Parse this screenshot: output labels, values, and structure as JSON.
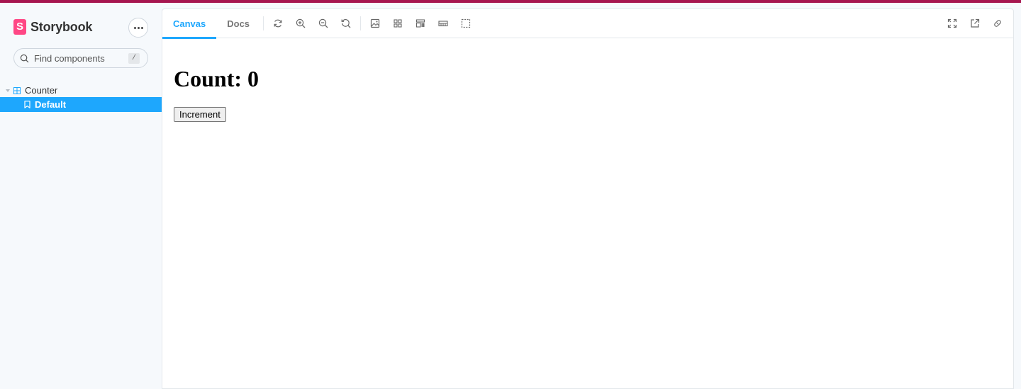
{
  "app": {
    "brand": "Storybook",
    "logo_letter": "S",
    "accent": "#1ea7fd",
    "brand_color": "#ff4785"
  },
  "sidebar": {
    "search_placeholder": "Find components",
    "search_shortcut": "/",
    "tree": [
      {
        "type": "component",
        "label": "Counter",
        "expanded": true,
        "children": [
          {
            "type": "story",
            "label": "Default",
            "selected": true
          }
        ]
      }
    ]
  },
  "toolbar": {
    "tabs": [
      {
        "label": "Canvas",
        "active": true
      },
      {
        "label": "Docs",
        "active": false
      }
    ],
    "tools": [
      "reload-icon",
      "zoom-in-icon",
      "zoom-out-icon",
      "zoom-reset-icon",
      "background-icon",
      "grid-icon",
      "viewport-icon",
      "measure-icon",
      "outline-icon"
    ],
    "right_tools": [
      "fullscreen-icon",
      "open-new-tab-icon",
      "copy-link-icon"
    ]
  },
  "preview": {
    "heading": "Count: 0",
    "button_label": "Increment"
  }
}
